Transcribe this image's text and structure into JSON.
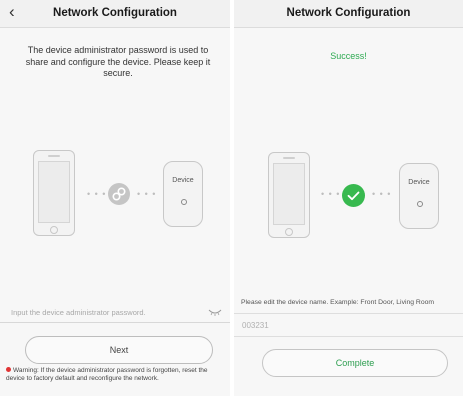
{
  "left": {
    "header": {
      "title": "Network Configuration",
      "back_icon": "‹"
    },
    "instruction": "The device administrator password is used to share and configure the device. Please keep it secure.",
    "diagram": {
      "dots_left": "• • •",
      "dots_right": "• • •",
      "device_label": "Device",
      "center_icon": "link-icon"
    },
    "password": {
      "placeholder": "Input the device administrator password."
    },
    "next_label": "Next",
    "warning": "Warning: If the device administrator password is forgotten, reset the device to factory default and reconfigure the network."
  },
  "right": {
    "header": {
      "title": "Network Configuration"
    },
    "success": "Success!",
    "diagram": {
      "dots_left": "• • •",
      "dots_right": "• • •",
      "device_label": "Device",
      "center_icon": "check-icon"
    },
    "edit_label": "Please edit the device name. Example: Front Door, Living Room",
    "device_name": "003231",
    "complete_label": "Complete"
  },
  "colors": {
    "success_green": "#38b94f",
    "warning_red": "#e03434",
    "link_gray": "#c5c5c5"
  }
}
